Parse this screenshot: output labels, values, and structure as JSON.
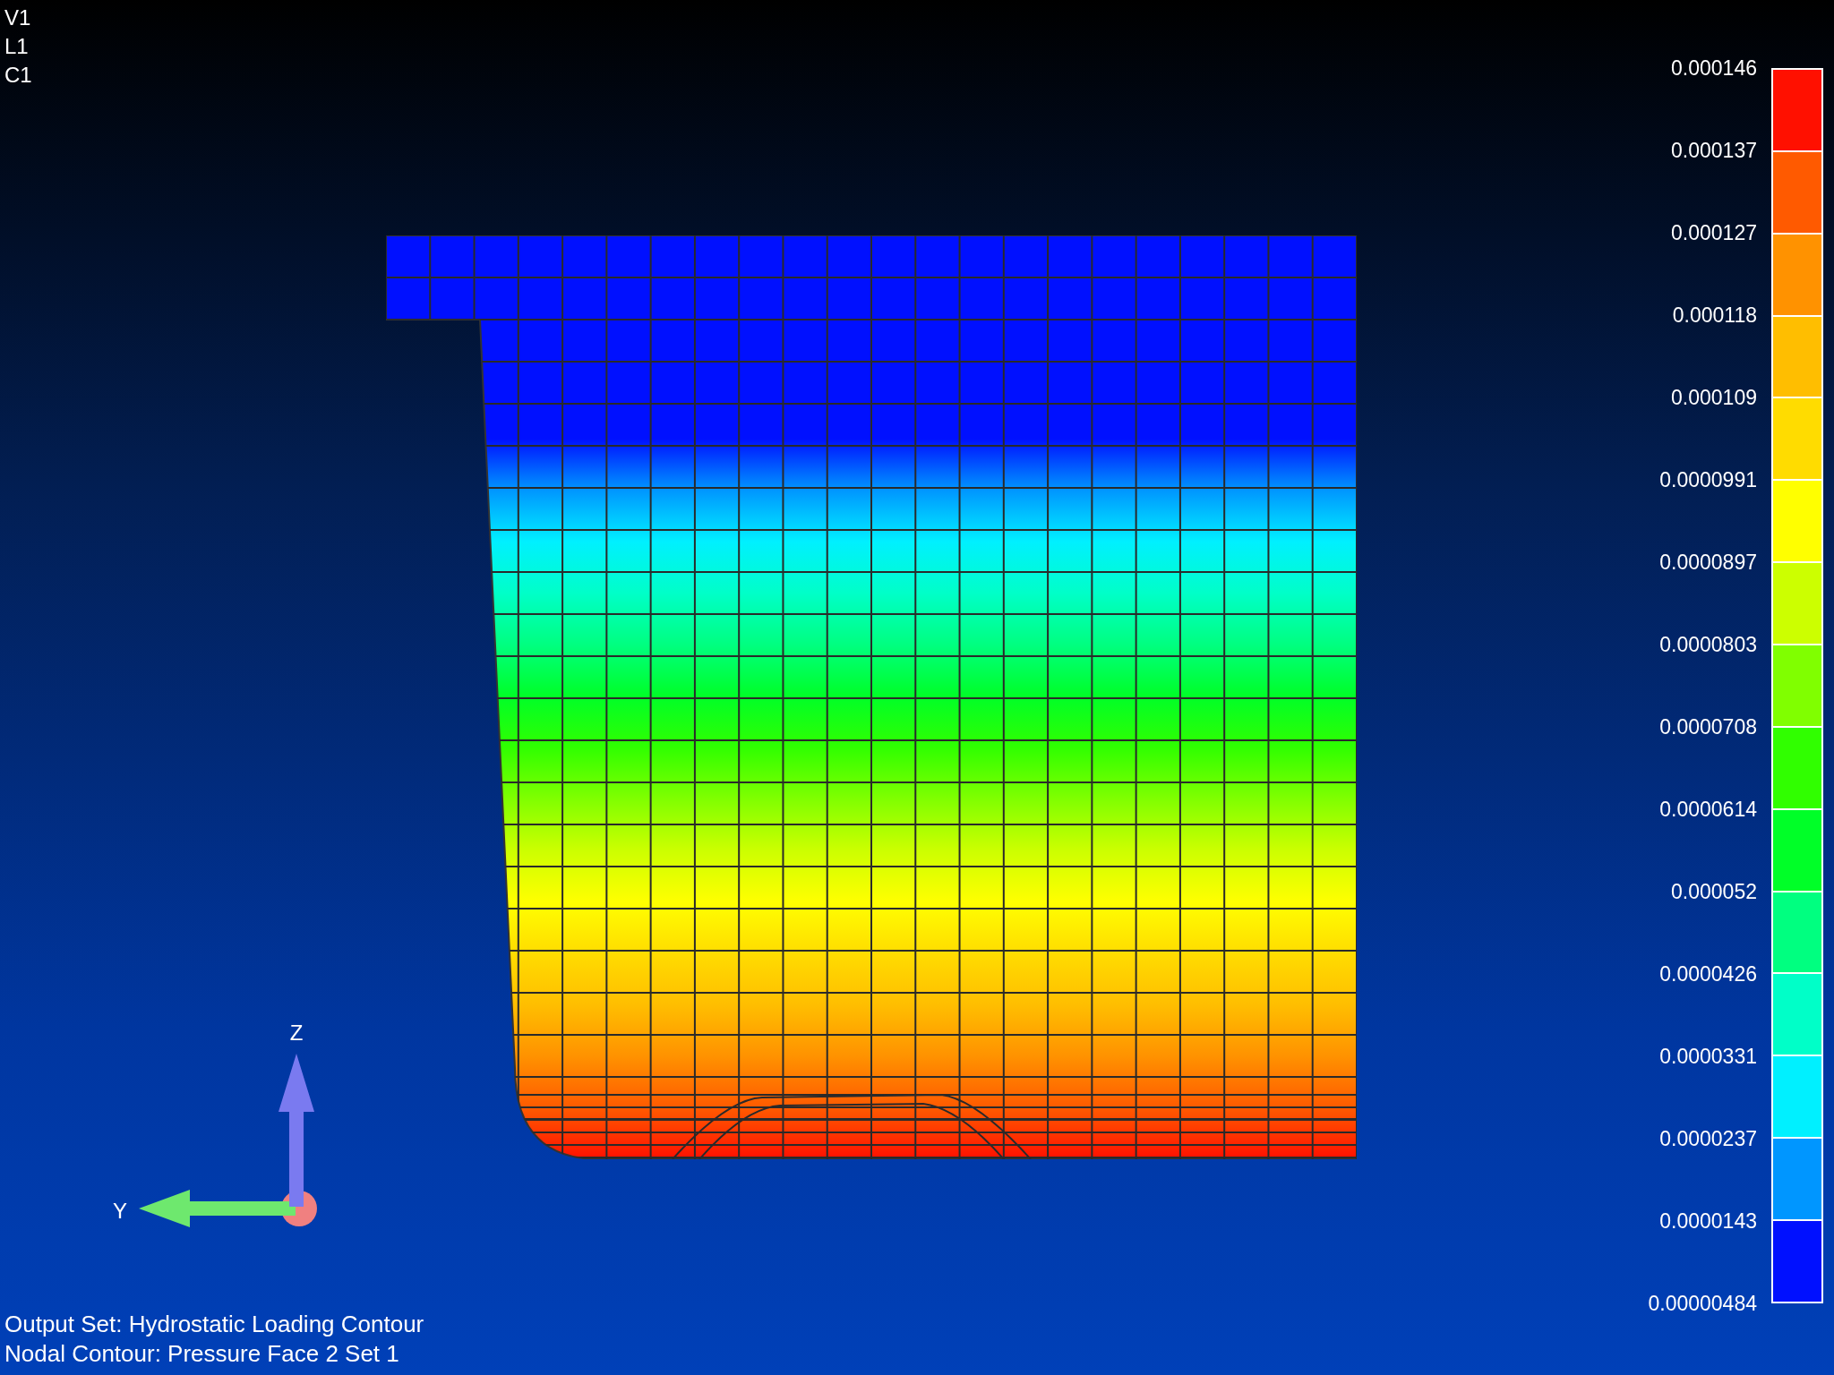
{
  "view_labels": [
    "V1",
    "L1",
    "C1"
  ],
  "legend": {
    "labels": [
      "0.000146",
      "0.000137",
      "0.000127",
      "0.000118",
      "0.000109",
      "0.0000991",
      "0.0000897",
      "0.0000803",
      "0.0000708",
      "0.0000614",
      "0.000052",
      "0.0000426",
      "0.0000331",
      "0.0000237",
      "0.0000143",
      "0.00000484"
    ],
    "bands": [
      {
        "color": "#ff1000"
      },
      {
        "color": "#ff5a00"
      },
      {
        "color": "#ff9200"
      },
      {
        "color": "#ffbe00"
      },
      {
        "color": "#ffdc00"
      },
      {
        "color": "#ffff00"
      },
      {
        "color": "#ccff00"
      },
      {
        "color": "#80ff00"
      },
      {
        "color": "#30ff00"
      },
      {
        "color": "#00ff28"
      },
      {
        "color": "#00ff80"
      },
      {
        "color": "#00ffc8"
      },
      {
        "color": "#00f0ff"
      },
      {
        "color": "#0096ff"
      },
      {
        "color": "#0010ff"
      }
    ]
  },
  "triad": {
    "z": "Z",
    "y": "Y"
  },
  "footer": [
    "Output Set: Hydrostatic Loading Contour",
    "Nodal Contour: Pressure Face 2 Set 1"
  ]
}
